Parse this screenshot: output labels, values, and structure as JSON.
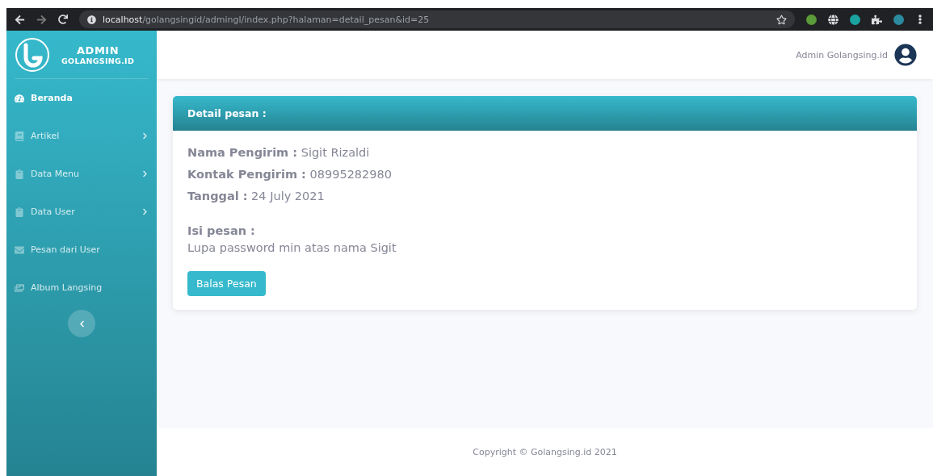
{
  "browser": {
    "url_host": "localhost",
    "url_path": "/golangsingid/admingl/index.php?halaman=detail_pesan&id=25"
  },
  "sidebar": {
    "brand_title": "ADMIN",
    "brand_subtitle": "GOLANGSING.ID",
    "items": [
      {
        "kind": "dashboard",
        "label": "Beranda",
        "selected": true,
        "has_submenu": false
      },
      {
        "kind": "book",
        "label": "Artikel",
        "selected": false,
        "has_submenu": true
      },
      {
        "kind": "clipboard",
        "label": "Data Menu",
        "selected": false,
        "has_submenu": true
      },
      {
        "kind": "clipboard",
        "label": "Data User",
        "selected": false,
        "has_submenu": true
      },
      {
        "kind": "mail",
        "label": "Pesan dari User",
        "selected": false,
        "has_submenu": false
      },
      {
        "kind": "images",
        "label": "Album Langsing",
        "selected": false,
        "has_submenu": false
      }
    ]
  },
  "topbar": {
    "user_name": "Admin Golangsing.id"
  },
  "card": {
    "title": "Detail pesan :",
    "lines": [
      "**Nama Pengirim :** Sigit Rizaldi",
      "**Kontak Pengirim :** 08995282980",
      "**Tanggal :** 24 July 2021"
    ],
    "message_label": "Isi pesan :",
    "message": "Lupa password min atas nama Sigit",
    "button": "Balas Pesan"
  },
  "footer": {
    "text": "Copyright © Golangsing.id 2021"
  }
}
